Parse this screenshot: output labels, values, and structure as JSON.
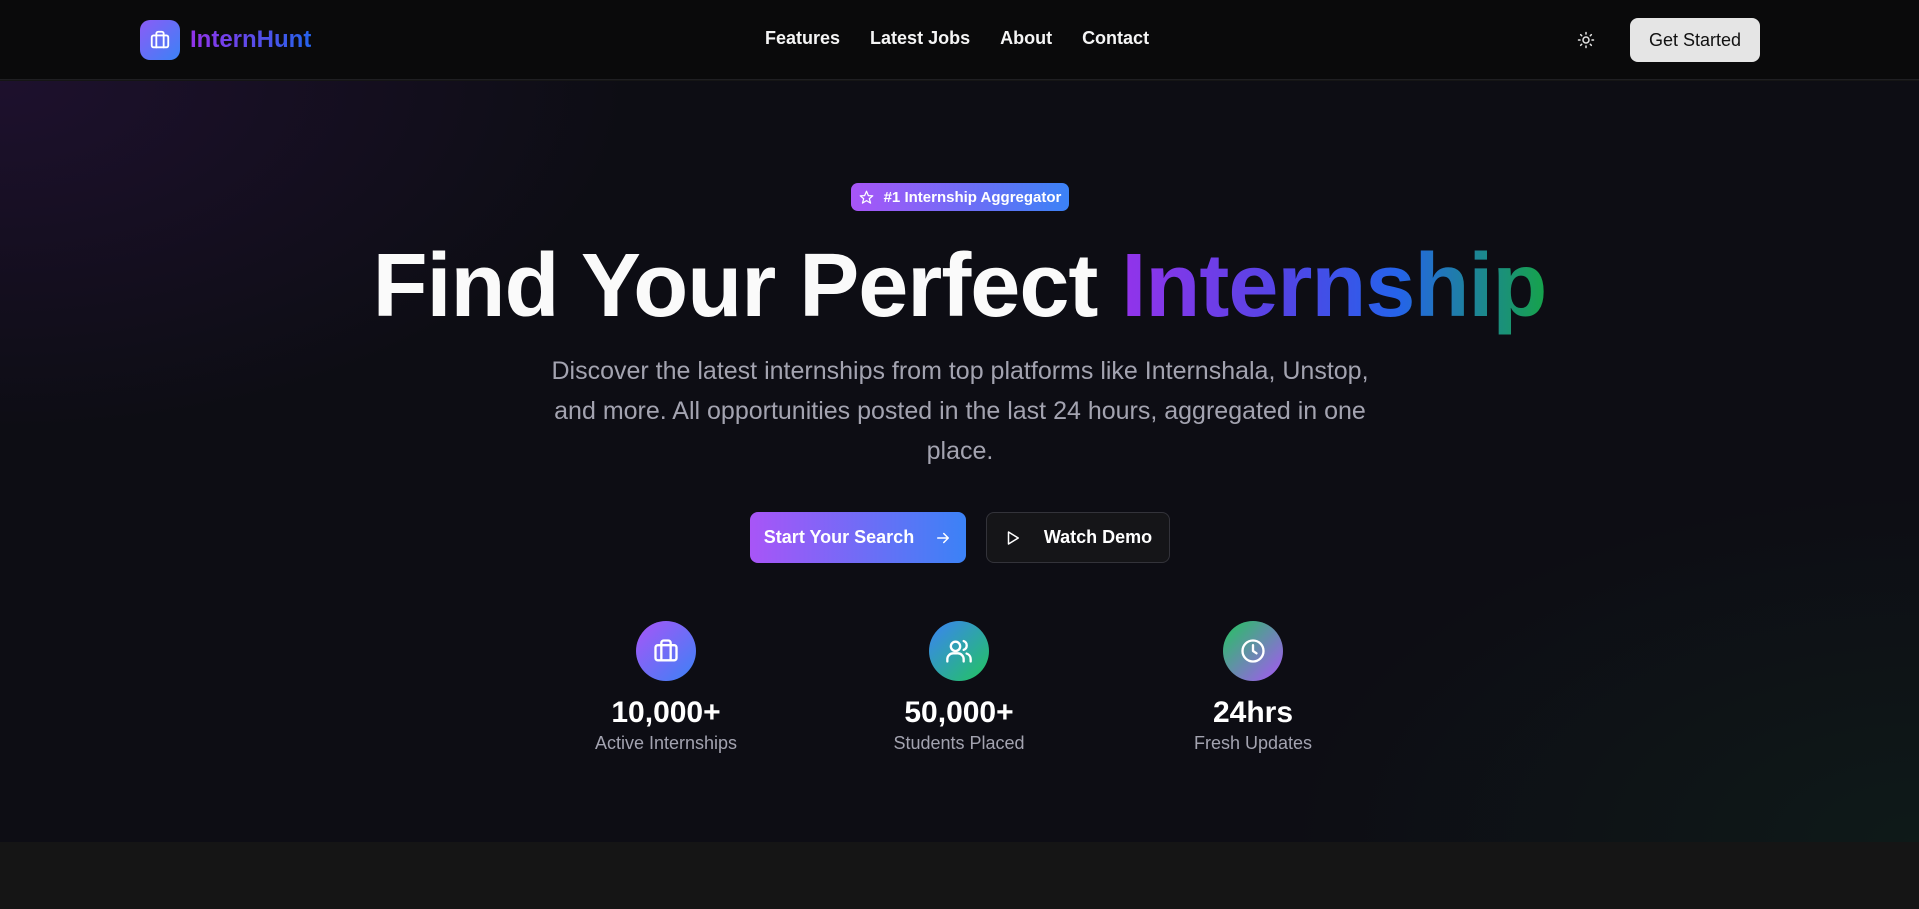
{
  "brand": {
    "name": "InternHunt"
  },
  "nav": [
    "Features",
    "Latest Jobs",
    "About",
    "Contact"
  ],
  "header": {
    "cta_label": "Get Started",
    "theme_icon": "sun-icon"
  },
  "hero": {
    "badge": "#1 Internship Aggregator",
    "headline_plain": "Find Your Perfect ",
    "headline_accent": "Internship",
    "subtitle": "Discover the latest internships from top platforms like Internshala, Unstop, and more. All opportunities posted in the last 24 hours, aggregated in one place.",
    "primary_button": "Start Your Search",
    "secondary_button": "Watch Demo"
  },
  "stats": [
    {
      "value": "10,000+",
      "label": "Active Internships",
      "icon": "briefcase-icon"
    },
    {
      "value": "50,000+",
      "label": "Students Placed",
      "icon": "users-icon"
    },
    {
      "value": "24hrs",
      "label": "Fresh Updates",
      "icon": "clock-icon"
    }
  ],
  "colors": {
    "accent_purple": "#a855f7",
    "accent_blue": "#3b82f6",
    "accent_green": "#16a34a",
    "background": "#0d0d14"
  }
}
